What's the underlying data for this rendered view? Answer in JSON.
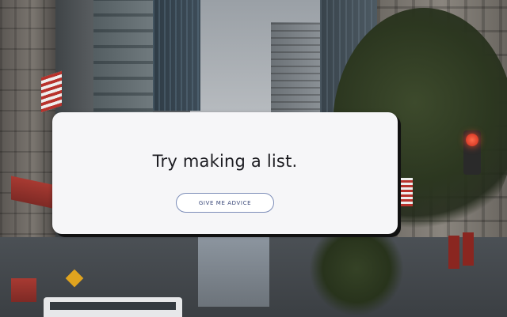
{
  "card": {
    "message": "Try making a list.",
    "button_label": "GIVE ME ADVICE"
  },
  "colors": {
    "card_background": "#f6f6f8",
    "button_border": "#7c8db8",
    "button_text": "#3c4a7a",
    "title_text": "#1d1d22"
  },
  "background": {
    "icon": "city-street-photo"
  }
}
